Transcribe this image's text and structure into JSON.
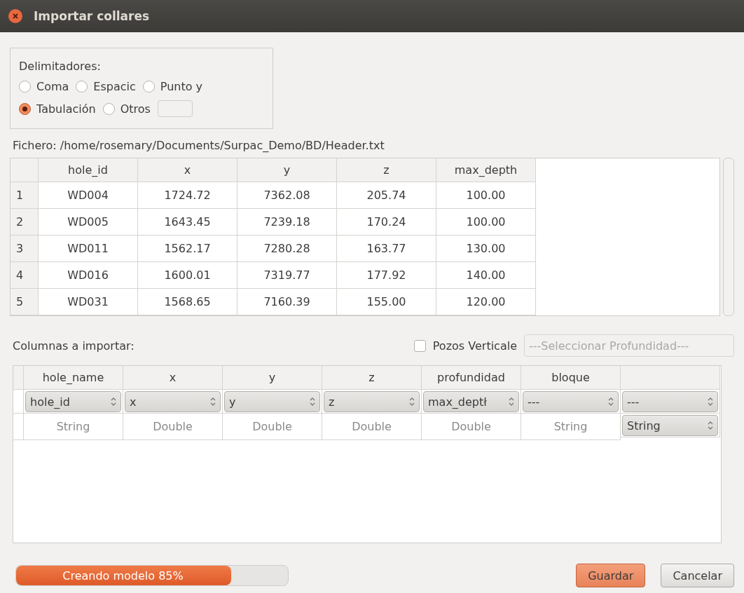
{
  "window": {
    "title": "Importar collares"
  },
  "delimiters": {
    "label": "Delimitadores:",
    "options": [
      {
        "label": "Coma",
        "selected": false
      },
      {
        "label": "Espacic",
        "selected": false
      },
      {
        "label": "Punto y",
        "selected": false
      },
      {
        "label": "Tabulación",
        "selected": true
      },
      {
        "label": "Otros",
        "selected": false
      }
    ]
  },
  "file_label": "Fichero: /home/rosemary/Documents/Surpac_Demo/BD/Header.txt",
  "preview_table": {
    "columns": [
      "hole_id",
      "x",
      "y",
      "z",
      "max_depth"
    ],
    "rows": [
      {
        "number": "1",
        "cells": [
          "WD004",
          "1724.72",
          "7362.08",
          "205.74",
          "100.00"
        ]
      },
      {
        "number": "2",
        "cells": [
          "WD005",
          "1643.45",
          "7239.18",
          "170.24",
          "100.00"
        ]
      },
      {
        "number": "3",
        "cells": [
          "WD011",
          "1562.17",
          "7280.28",
          "163.77",
          "130.00"
        ]
      },
      {
        "number": "4",
        "cells": [
          "WD016",
          "1600.01",
          "7319.77",
          "177.92",
          "140.00"
        ]
      },
      {
        "number": "5",
        "cells": [
          "WD031",
          "1568.65",
          "7160.39",
          "155.00",
          "120.00"
        ]
      }
    ]
  },
  "columns_label": "Columnas a importar:",
  "vertical_wells": {
    "label": "Pozos Verticale",
    "checked": false
  },
  "depth_select": {
    "placeholder": "---Seleccionar Profundidad---",
    "disabled": true
  },
  "import_table": {
    "columns": [
      "hole_name",
      "x",
      "y",
      "z",
      "profundidad",
      "bloque",
      ""
    ],
    "mapping": [
      "hole_id",
      "x",
      "y",
      "z",
      "max_deptł",
      "---",
      "---"
    ],
    "types": [
      {
        "kind": "text",
        "value": "String"
      },
      {
        "kind": "text",
        "value": "Double"
      },
      {
        "kind": "text",
        "value": "Double"
      },
      {
        "kind": "text",
        "value": "Double"
      },
      {
        "kind": "text",
        "value": "Double"
      },
      {
        "kind": "text",
        "value": "String"
      },
      {
        "kind": "combo",
        "value": "String"
      }
    ]
  },
  "progress": {
    "label": "Creando modelo 85%",
    "level": 0.79
  },
  "buttons": [
    {
      "label": "Guardar",
      "kind": "primary"
    },
    {
      "label": "Cancelar",
      "kind": "normal"
    }
  ]
}
